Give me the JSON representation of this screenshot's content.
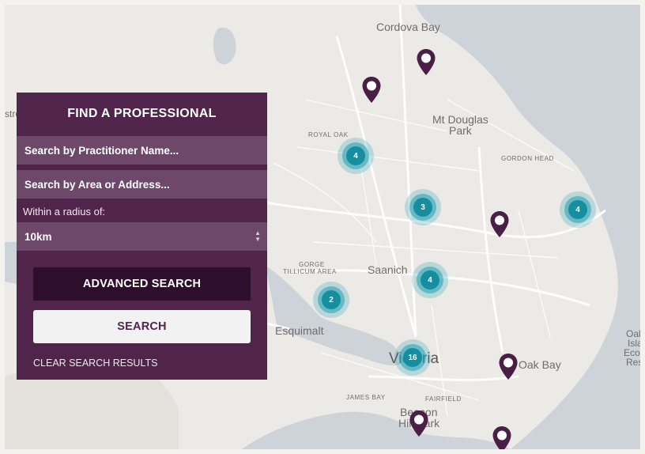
{
  "panel": {
    "title": "FIND A PROFESSIONAL",
    "name_placeholder": "Search by Practitioner Name...",
    "area_placeholder": "Search by Area or Address...",
    "radius_label": "Within a radius of:",
    "radius_value": "10km",
    "advanced_label": "ADVANCED SEARCH",
    "search_label": "SEARCH",
    "clear_label": "CLEAR SEARCH RESULTS"
  },
  "map": {
    "labels": {
      "cordova_bay": "Cordova Bay",
      "royal_oak": "ROYAL OAK",
      "mt_douglas": "Mt Douglas",
      "mt_douglas_2": "Park",
      "gordon_head": "GORDON HEAD",
      "gorge": "GORGE",
      "tillicum": "TILLICUM AREA",
      "saanich": "Saanich",
      "esquimalt": "Esquimalt",
      "victoria": "Victoria",
      "oak_bay": "Oak Bay",
      "james_bay": "JAMES BAY",
      "fairfield": "FAIRFIELD",
      "beacon": "Beacon",
      "hill_park": "Hill Park",
      "oak_isl_1": "Oak",
      "oak_isl_2": "Isla",
      "oak_isl_3": "Ecol",
      "oak_isl_4": "Res",
      "left_edge": "stream"
    },
    "clusters": [
      {
        "count": "4"
      },
      {
        "count": "3"
      },
      {
        "count": "4"
      },
      {
        "count": "4"
      },
      {
        "count": "2"
      },
      {
        "count": "16"
      }
    ],
    "colors": {
      "pin": "#4a1f45",
      "cluster": "#178e9f",
      "panel": "#51244c"
    }
  }
}
